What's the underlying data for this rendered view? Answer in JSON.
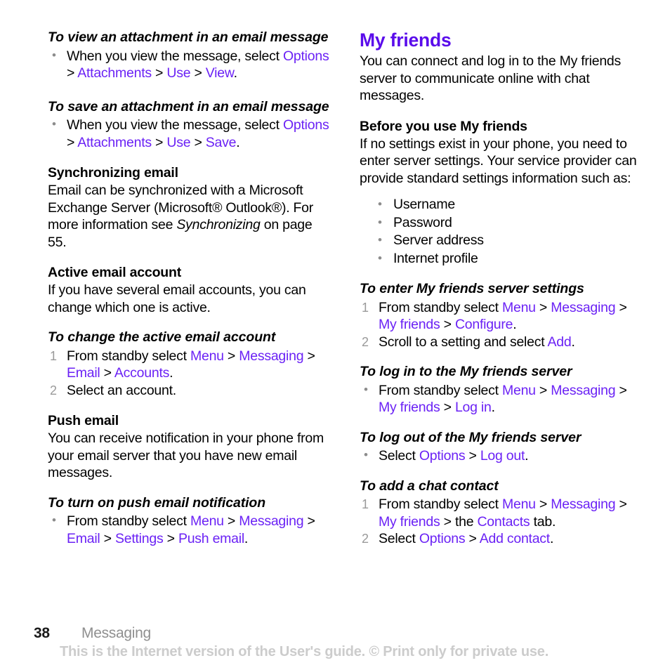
{
  "document": {
    "page_number": "38",
    "chapter": "Messaging",
    "watermark": "This is the Internet version of the User's guide. © Print only for private use."
  },
  "left_column": {
    "task_view_attachment": {
      "title": "To view an attachment in an email message",
      "step": {
        "lead": "When you view the message, select ",
        "links": [
          "Options",
          "Attachments",
          "Use",
          "View"
        ],
        "trailing": "."
      }
    },
    "task_save_attachment": {
      "title": "To save an attachment in an email message",
      "step": {
        "lead": "When you view the message, select ",
        "links": [
          "Options",
          "Attachments",
          "Use",
          "Save"
        ],
        "trailing": "."
      }
    },
    "sync_email": {
      "title": "Synchronizing email",
      "body_part1": "Email can be synchronized with a Microsoft Exchange Server (Microsoft® Outlook®). For more information see ",
      "body_italic": "Synchronizing",
      "body_part2": " on page 55."
    },
    "active_account": {
      "title": "Active email account",
      "body": "If you have several email accounts, you can change which one is active."
    },
    "task_change_account": {
      "title": "To change the active email account",
      "step1": {
        "lead": "From standby select ",
        "links": [
          "Menu",
          "Messaging",
          "Email",
          "Accounts"
        ],
        "trailing": "."
      },
      "step2": "Select an account."
    },
    "push_email": {
      "title": "Push email",
      "body": "You can receive notification in your phone from your email server that you have new email messages."
    },
    "task_push_notification": {
      "title": "To turn on push email notification",
      "step": {
        "lead": "From standby select ",
        "links": [
          "Menu",
          "Messaging",
          "Email",
          "Settings",
          "Push email"
        ],
        "trailing": "."
      }
    }
  },
  "right_column": {
    "my_friends": {
      "title": "My friends",
      "body": "You can connect and log in to the My friends server to communicate online with chat messages."
    },
    "before_use": {
      "title": "Before you use My friends",
      "body": "If no settings exist in your phone, you need to enter server settings. Your service provider can provide standard settings information such as:",
      "items": [
        "Username",
        "Password",
        "Server address",
        "Internet profile"
      ]
    },
    "task_enter_settings": {
      "title": "To enter My friends server settings",
      "step1": {
        "lead": "From standby select ",
        "links": [
          "Menu",
          "Messaging",
          "My friends",
          "Configure"
        ],
        "trailing": "."
      },
      "step2": {
        "lead": "Scroll to a setting and select ",
        "link": "Add",
        "trailing": "."
      }
    },
    "task_log_in": {
      "title": "To log in to the My friends server",
      "step": {
        "lead": "From standby select ",
        "links": [
          "Menu",
          "Messaging",
          "My friends",
          "Log in"
        ],
        "trailing": "."
      }
    },
    "task_log_out": {
      "title": "To log out of the My friends server",
      "step": {
        "lead": "Select ",
        "links": [
          "Options",
          "Log out"
        ],
        "trailing": "."
      }
    },
    "task_add_contact": {
      "title": "To add a chat contact",
      "step1": {
        "lead": "From standby select ",
        "links": [
          "Menu",
          "Messaging",
          "My friends"
        ],
        "mid": " the ",
        "link_contacts": "Contacts",
        "trailing": " tab."
      },
      "step2": {
        "lead": "Select ",
        "links": [
          "Options",
          "Add contact"
        ],
        "trailing": "."
      }
    }
  },
  "colors": {
    "link": "#6b22f5",
    "heading": "#5a0ceb",
    "marker": "#8c8c8c",
    "chapter": "#8f8f8f",
    "watermark": "#cccccc"
  },
  "separator": " > "
}
